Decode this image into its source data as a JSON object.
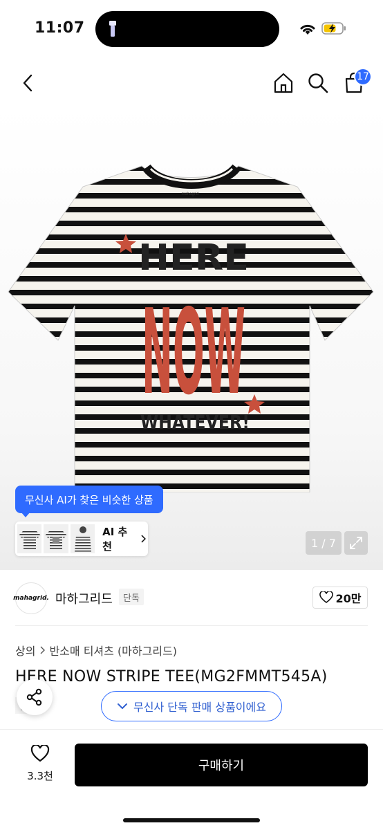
{
  "status_bar": {
    "time": "11:07"
  },
  "nav": {
    "cart_count": "17"
  },
  "hero": {
    "ai_tooltip": "무신사 AI가 찾은 비슷한 상품",
    "ai_recommend_label": "AI 추천",
    "pager": "1 / 7",
    "print_lines": [
      "HERE",
      "NOW",
      "WHATEVER!"
    ],
    "neck_label": "mahagrid"
  },
  "brand": {
    "logo_text": "mahagrid.",
    "name": "마하그리드",
    "tag": "단독",
    "like_count": "20만"
  },
  "breadcrumb": [
    "상의",
    "반소매 티셔츠 (마하그리드)"
  ],
  "product": {
    "title": "HERE NOW STRIPE TEE(MG2FMMT545A)",
    "tag": "단독",
    "exclusive_notice": "무신사 단독 판매 상품이에요"
  },
  "bottom": {
    "wish_count": "3.3천",
    "buy_label": "구매하기"
  },
  "colors": {
    "accent": "#2f6bff",
    "print_red": "#c8503c",
    "stripe": "#111111"
  }
}
